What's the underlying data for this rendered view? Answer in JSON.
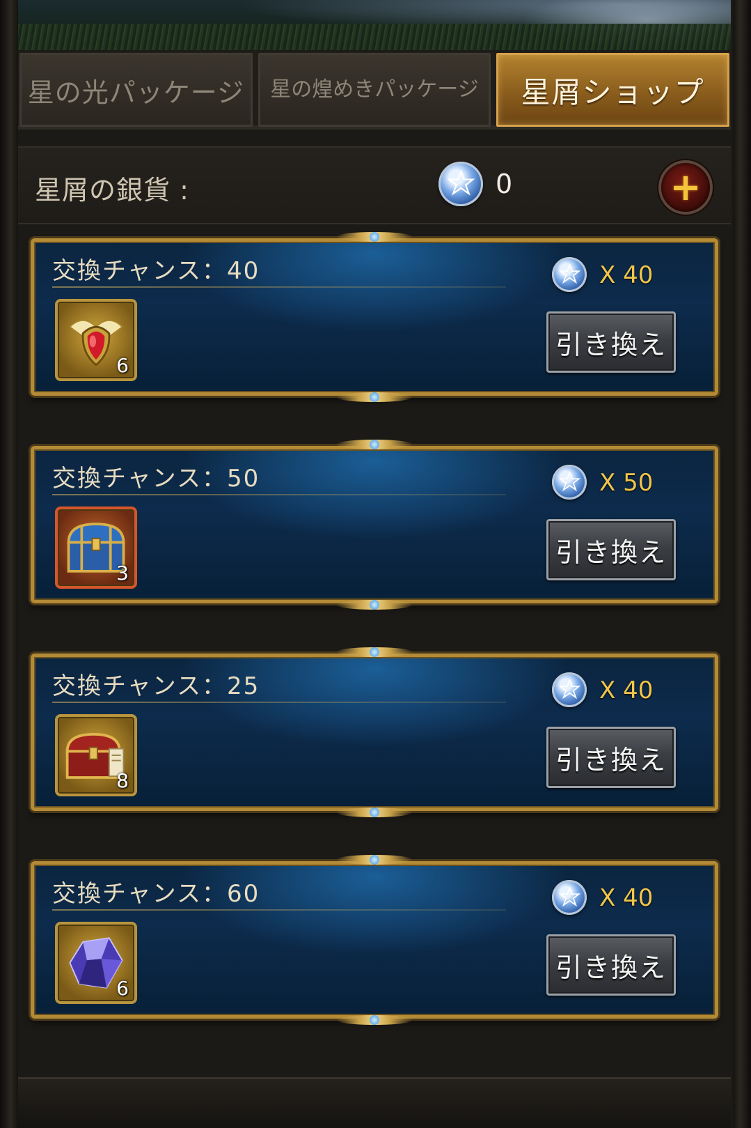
{
  "tabs": [
    {
      "label": "星の光パッケージ",
      "active": false
    },
    {
      "label": "星の煌めきパッケージ",
      "active": false
    },
    {
      "label": "星屑ショップ",
      "active": true
    }
  ],
  "currency": {
    "label": "星屑の銀貨 :",
    "amount": "0",
    "icon": "star-coin-icon",
    "add_icon": "plus-icon"
  },
  "offers": [
    {
      "chance": "交換チャンス：40",
      "price": "X 40",
      "item_icon": "jewel-amulet-icon",
      "quantity": "6",
      "button": "引き換え"
    },
    {
      "chance": "交換チャンス：50",
      "price": "X 50",
      "item_icon": "blue-chest-icon",
      "quantity": "3",
      "button": "引き換え"
    },
    {
      "chance": "交換チャンス：25",
      "price": "X 40",
      "item_icon": "red-chest-icon",
      "quantity": "8",
      "button": "引き換え"
    },
    {
      "chance": "交換チャンス：60",
      "price": "X 40",
      "item_icon": "crystal-icon",
      "quantity": "6",
      "button": "引き換え"
    }
  ],
  "colors": {
    "accent_gold": "#b38a36",
    "price_text": "#f0c64a",
    "card_blue": "#0d2b4c",
    "active_tab": "#b3822e"
  }
}
